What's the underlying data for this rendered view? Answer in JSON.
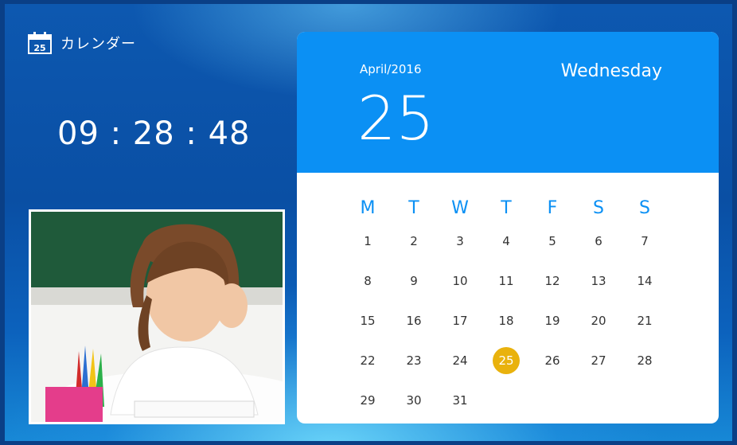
{
  "app": {
    "title": "カレンダー",
    "icon": "calendar-icon",
    "icon_day": "25"
  },
  "clock": {
    "time": "09 : 28 : 48"
  },
  "calendar": {
    "month_year": "April/2016",
    "weekday": "Wednesday",
    "day": "25",
    "accent_color": "#0b90f4",
    "highlight_color": "#e9b20d",
    "weekday_headers": [
      "M",
      "T",
      "W",
      "T",
      "F",
      "S",
      "S"
    ],
    "weeks": [
      [
        "1",
        "2",
        "3",
        "4",
        "5",
        "6",
        "7"
      ],
      [
        "8",
        "9",
        "10",
        "11",
        "12",
        "13",
        "14"
      ],
      [
        "15",
        "16",
        "17",
        "18",
        "19",
        "20",
        "21"
      ],
      [
        "22",
        "23",
        "24",
        "25",
        "26",
        "27",
        "28"
      ],
      [
        "29",
        "30",
        "31",
        "",
        "",
        "",
        ""
      ]
    ]
  }
}
